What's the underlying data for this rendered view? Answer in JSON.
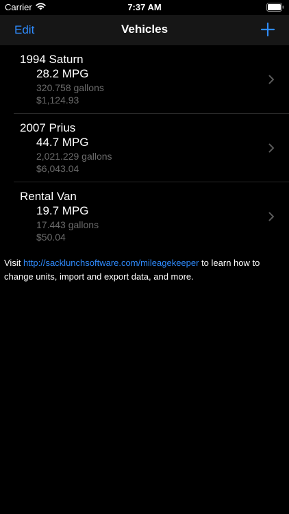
{
  "status_bar": {
    "carrier": "Carrier",
    "time": "7:37 AM",
    "wifi_icon": "wifi-icon",
    "battery_icon": "battery-icon"
  },
  "nav": {
    "edit_label": "Edit",
    "title": "Vehicles",
    "add_icon": "plus-icon"
  },
  "vehicles": [
    {
      "name": "1994 Saturn",
      "mpg": "28.2 MPG",
      "gallons": "320.758 gallons",
      "cost": "$1,124.93"
    },
    {
      "name": "2007 Prius",
      "mpg": "44.7 MPG",
      "gallons": "2,021.229 gallons",
      "cost": "$6,043.04"
    },
    {
      "name": "Rental Van",
      "mpg": "19.7 MPG",
      "gallons": "17.443 gallons",
      "cost": "$50.04"
    }
  ],
  "info": {
    "prefix": "Visit ",
    "link_text": "http://sacklunchsoftware.com/mileagekeeper",
    "suffix": " to learn how to change units, import and export data, and more."
  },
  "colors": {
    "background": "#000000",
    "nav_background": "#161616",
    "accent": "#2f8cff",
    "secondary_text": "#6b6b6b",
    "separator": "#2a2a2a"
  }
}
